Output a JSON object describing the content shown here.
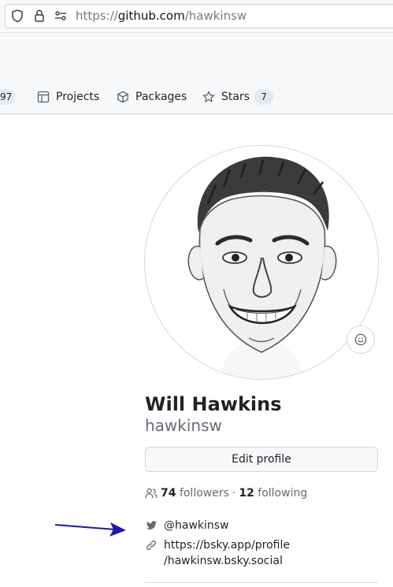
{
  "browser": {
    "url_scheme": "https://",
    "url_host": "github.com",
    "url_path": "/hawkinsw"
  },
  "tabs": {
    "repositories_count_partial": "97",
    "projects_label": "Projects",
    "packages_label": "Packages",
    "stars_label": "Stars",
    "stars_count": "7"
  },
  "profile": {
    "full_name": "Will Hawkins",
    "username": "hawkinsw",
    "edit_label": "Edit profile",
    "followers_count": "74",
    "followers_label": "followers",
    "separator": "·",
    "following_count": "12",
    "following_label": "following",
    "twitter_handle": "@hawkinsw",
    "website_line1": "https://bsky.app/profile",
    "website_line2": "/hawkinsw.bsky.social"
  },
  "colors": {
    "annotation_arrow": "#1a1aa8",
    "muted_text": "#636c76",
    "border": "#d0d7de"
  }
}
